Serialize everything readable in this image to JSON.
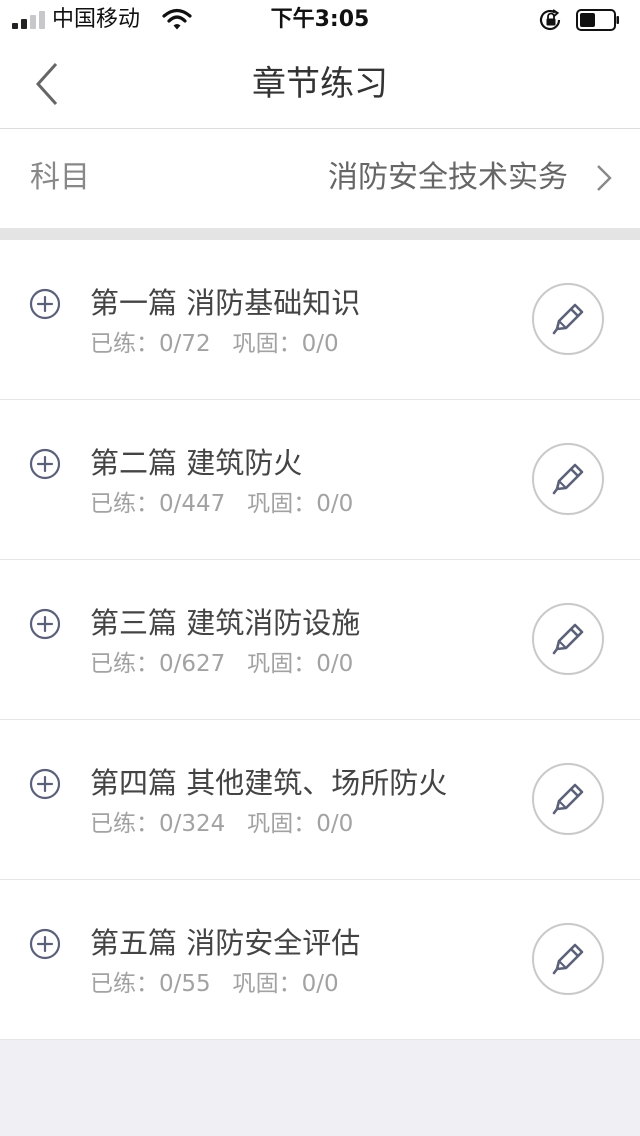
{
  "status_bar": {
    "carrier": "中国移动",
    "time": "下午3:05",
    "icons": [
      "signal-icon",
      "wifi-icon",
      "orientation-lock-icon",
      "battery-icon"
    ]
  },
  "nav": {
    "title": "章节练习",
    "back_icon": "chevron-left-icon"
  },
  "subject": {
    "label": "科目",
    "value": "消防安全技术实务",
    "chevron_icon": "chevron-right-icon"
  },
  "stat_labels": {
    "practiced": "已练：",
    "consolidated": "巩固："
  },
  "chapters": [
    {
      "title": "第一篇 消防基础知识",
      "practiced": "0/72",
      "consolidated": "0/0"
    },
    {
      "title": "第二篇 建筑防火",
      "practiced": "0/447",
      "consolidated": "0/0"
    },
    {
      "title": "第三篇 建筑消防设施",
      "practiced": "0/627",
      "consolidated": "0/0"
    },
    {
      "title": "第四篇 其他建筑、场所防火",
      "practiced": "0/324",
      "consolidated": "0/0"
    },
    {
      "title": "第五篇 消防安全评估",
      "practiced": "0/55",
      "consolidated": "0/0"
    }
  ],
  "row_icons": {
    "expand": "plus-circle-icon",
    "practice": "pencil-icon"
  },
  "colors": {
    "background": "#f0f0f4",
    "divider": "#e4e4e4",
    "icon": "#5a6178",
    "text_primary": "#444444",
    "text_secondary": "#a2a2a2"
  }
}
